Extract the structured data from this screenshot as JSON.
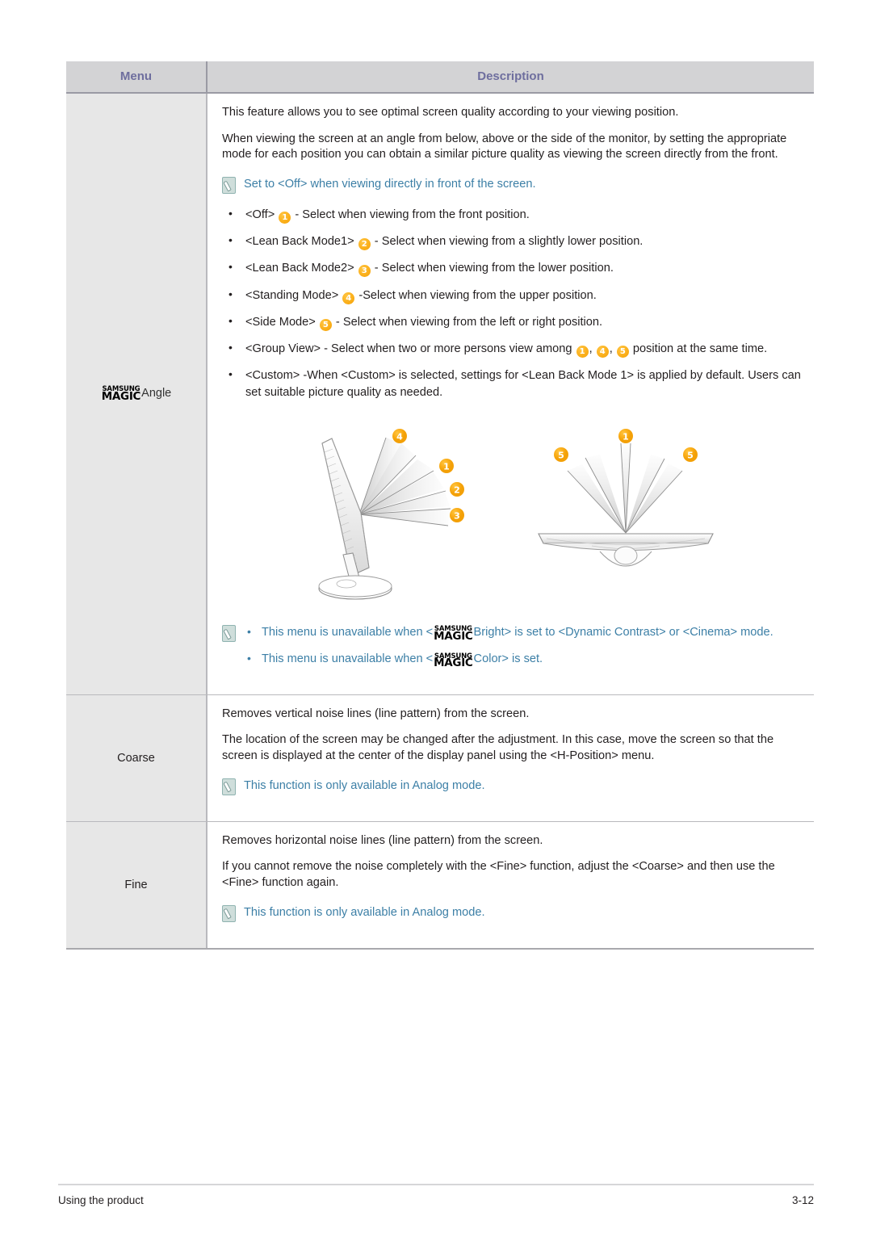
{
  "table": {
    "headers": {
      "menu": "Menu",
      "description": "Description"
    },
    "rows": [
      {
        "menu_logo_line1": "SAMSUNG",
        "menu_logo_line2": "MAGIC",
        "menu_label": "Angle",
        "paragraphs": [
          "This feature allows you to see optimal screen quality according to your viewing position.",
          "When viewing the screen at an angle from below, above or the side of the monitor, by setting the appropriate mode for each position you can obtain a similar picture quality as viewing the screen directly from the front."
        ],
        "note_top": "Set to <Off> when viewing directly in front of the screen.",
        "bullets": [
          {
            "prefix": "<Off> ",
            "badge": "1",
            "suffix": " - Select when viewing from the front position."
          },
          {
            "prefix": "<Lean Back Mode1> ",
            "badge": "2",
            "suffix": " - Select when viewing from a slightly lower position."
          },
          {
            "prefix": "<Lean Back Mode2> ",
            "badge": "3",
            "suffix": " - Select when viewing from the lower position."
          },
          {
            "prefix": "<Standing Mode> ",
            "badge": "4",
            "suffix": " -Select when viewing from the upper position."
          },
          {
            "prefix": "<Side Mode> ",
            "badge": "5",
            "suffix": " - Select when viewing from the left or right position."
          }
        ],
        "group_view": {
          "lead": "<Group View>  - Select when two or more persons view among ",
          "badges": [
            "1",
            "4",
            "5"
          ],
          "tail": " position at the same time."
        },
        "custom_bullet": " <Custom> -When <Custom> is selected, settings for <Lean Back Mode 1> is applied by default. Users can set suitable picture quality as needed.",
        "figure": {
          "left_view_badges": [
            "4",
            "1",
            "2",
            "3"
          ],
          "right_view_badges": [
            "5",
            "1",
            "5"
          ]
        },
        "bottom_notes": [
          {
            "pre": "This menu is unavailable when <",
            "logo1": "SAMSUNG",
            "logo2": "MAGIC",
            "post": "Bright> is set to <Dynamic Contrast> or <Cinema> mode."
          },
          {
            "pre": "This menu is unavailable when <",
            "logo1": "SAMSUNG",
            "logo2": "MAGIC",
            "post": "Color> is set."
          }
        ]
      },
      {
        "menu_label": "Coarse",
        "paragraphs": [
          "Removes vertical noise lines (line pattern) from the screen.",
          "The location of the screen may be changed after the adjustment. In this case, move the screen so that the screen is displayed at the center of the display panel using the <H-Position> menu."
        ],
        "note": "This function is only available in Analog mode."
      },
      {
        "menu_label": "Fine",
        "paragraphs": [
          "Removes horizontal noise lines (line pattern) from the screen.",
          "If you cannot remove the noise completely with the <Fine> function, adjust the <Coarse> and then use the <Fine> function again."
        ],
        "note": "This function is only available in Analog mode."
      }
    ]
  },
  "footer": {
    "left": "Using the product",
    "right": "3-12"
  },
  "colors": {
    "header_bg": "#d3d3d5",
    "header_text": "#6e6e9e",
    "menu_cell_bg": "#e7e7e7",
    "note_text": "#3c7fa6",
    "badge_orange": "#fbb01c",
    "body_text": "#231f20"
  }
}
